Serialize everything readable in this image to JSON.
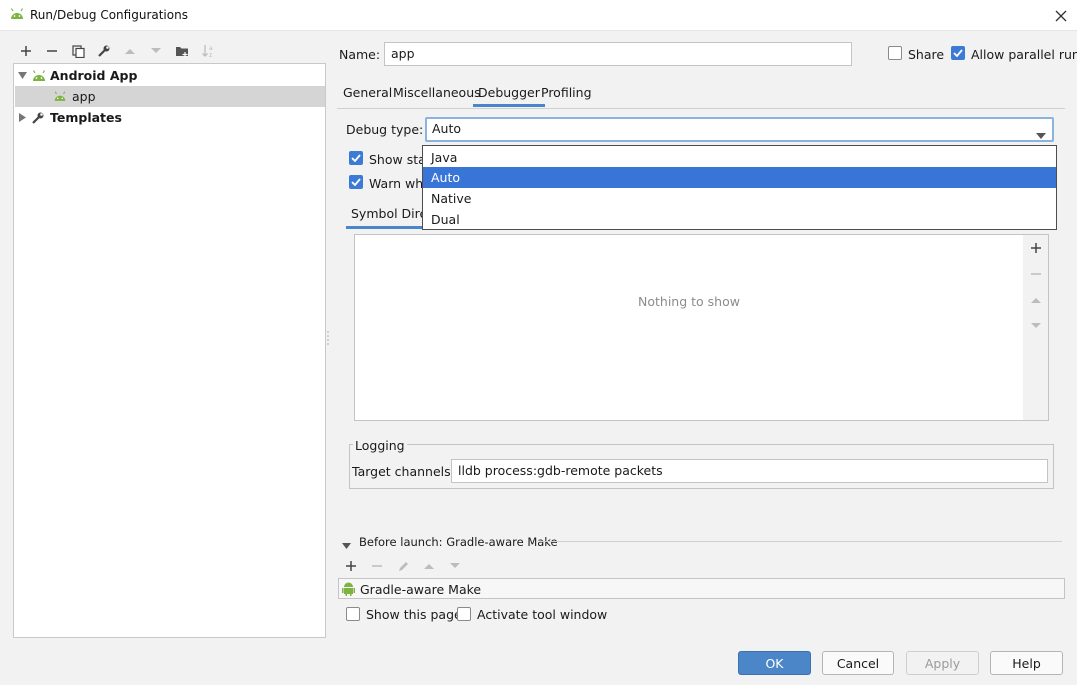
{
  "window": {
    "title": "Run/Debug Configurations",
    "close_icon": "close-icon"
  },
  "colors": {
    "accent": "#3875d6",
    "android_green": "#7cb342",
    "primary_button": "#4a86c8"
  },
  "left_toolbar": {
    "icons": [
      "add-icon",
      "remove-icon",
      "copy-icon",
      "wrench-icon",
      "move-up-icon",
      "move-down-icon",
      "new-folder-icon",
      "sort-icon"
    ]
  },
  "tree": {
    "items": [
      {
        "label": "Android App",
        "expanded": true,
        "icon": "android-icon"
      },
      {
        "label": "app",
        "selected": true,
        "icon": "android-icon"
      },
      {
        "label": "Templates",
        "expanded": false,
        "icon": "wrench-icon"
      }
    ]
  },
  "config": {
    "name_label": "Name:",
    "name_value": "app",
    "share_label": "Share",
    "share_checked": false,
    "allow_parallel_label": "Allow parallel run",
    "allow_parallel_checked": true
  },
  "tabs": [
    {
      "label": "General",
      "active": false
    },
    {
      "label": "Miscellaneous",
      "active": false
    },
    {
      "label": "Debugger",
      "active": true
    },
    {
      "label": "Profiling",
      "active": false
    }
  ],
  "debugger": {
    "debug_type_label": "Debug type:",
    "debug_type_value": "Auto",
    "debug_type_options": [
      "Java",
      "Auto",
      "Native",
      "Dual"
    ],
    "selected_option": "Auto",
    "show_static_label": "Show stat",
    "show_static_checked": true,
    "warn_label": "Warn whe",
    "warn_checked": true,
    "symbol_tab_label": "Symbol Directories",
    "empty_text": "Nothing to show"
  },
  "logging": {
    "group_title": "Logging",
    "target_label": "Target channels:",
    "target_value": "lldb process:gdb-remote packets"
  },
  "before_launch": {
    "title": "Before launch: Gradle-aware Make",
    "task": "Gradle-aware Make",
    "show_page_label": "Show this page",
    "show_page_checked": false,
    "activate_label": "Activate tool window",
    "activate_checked": false
  },
  "buttons": {
    "ok": "OK",
    "cancel": "Cancel",
    "apply": "Apply",
    "help": "Help"
  }
}
